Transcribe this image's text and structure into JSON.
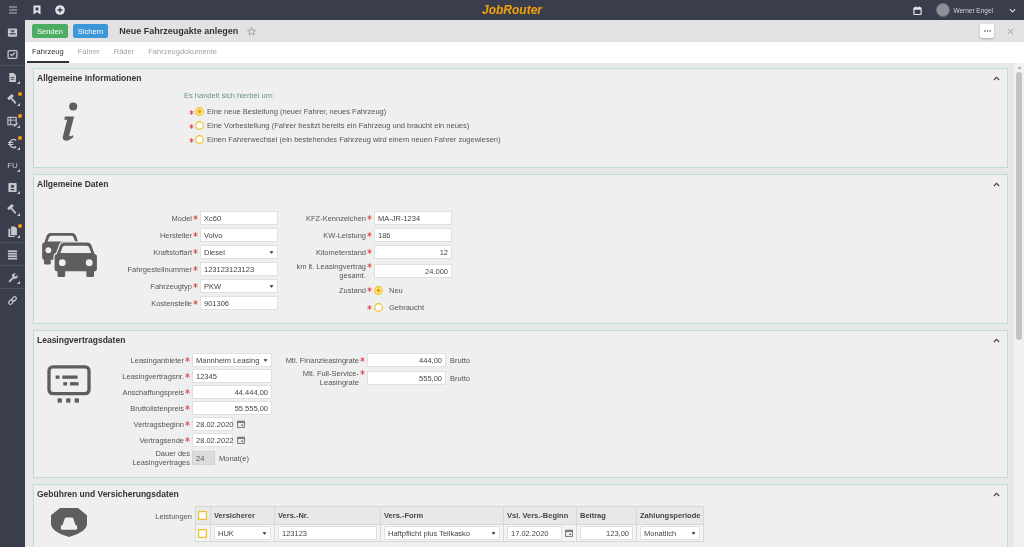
{
  "top_bar": {
    "logo": "JobRouter",
    "user_name": "Werner Engel"
  },
  "sidebar": {
    "groups": [
      {
        "items": [
          {
            "notification": false,
            "submenu": false
          },
          {
            "notification": false,
            "submenu": false
          }
        ]
      },
      {
        "items": [
          {
            "notification": false,
            "submenu": true
          },
          {
            "notification": true,
            "submenu": true
          },
          {
            "notification": true,
            "submenu": true
          },
          {
            "notification": true,
            "submenu": true
          },
          {
            "label": "FU",
            "notification": false,
            "submenu": true
          },
          {
            "notification": false,
            "submenu": true
          },
          {
            "notification": false,
            "submenu": true
          },
          {
            "notification": true,
            "submenu": true
          }
        ]
      },
      {
        "items": [
          {
            "notification": false,
            "submenu": false
          }
        ]
      },
      {
        "items": [
          {
            "notification": false,
            "submenu": true
          }
        ]
      },
      {
        "items": [
          {
            "notification": false,
            "submenu": false
          }
        ]
      }
    ]
  },
  "toolbar": {
    "buttons": [
      {
        "label": "Senden",
        "kind": "success"
      },
      {
        "label": "Sichern",
        "kind": "primary"
      }
    ],
    "title": "Neue Fahrzeugakte anlegen",
    "favorite": false
  },
  "tabs": [
    {
      "label": "Fahrzeug",
      "selected": true
    },
    {
      "label": "Fahrer",
      "selected": false
    },
    {
      "label": "Räder",
      "selected": false
    },
    {
      "label": "Fahrzeugdokumente",
      "selected": false
    }
  ],
  "sections": [
    {
      "kind": "info",
      "title": "Allgemeine Informationen",
      "expanded": true,
      "question": "Es handelt sich hierbei um:",
      "options": [
        {
          "label": "Eine neue Bestellung (neuer Fahrer, neues Fahrzeug)",
          "required": true,
          "selected": true
        },
        {
          "label": "Eine Vorbestellung (Fahrer besitzt bereits ein Fahrzeug und braucht ein neues)",
          "required": true,
          "selected": false
        },
        {
          "label": "Einen Fahrerwechsel (ein bestehendes Fahrzeug wird einem neuen Fahrer zugewiesen)",
          "required": true,
          "selected": false
        }
      ]
    },
    {
      "kind": "vehicle",
      "title": "Allgemeine Daten",
      "expanded": true,
      "columns": [
        [
          {
            "label": "Model",
            "required": true,
            "kind": "text",
            "value": "Xc60"
          },
          {
            "label": "Hersteller",
            "required": true,
            "kind": "text",
            "value": "Volvo"
          },
          {
            "label": "Kraftstoffart",
            "required": true,
            "kind": "select",
            "value": "Diesel"
          },
          {
            "label": "Fahrgestellnummer",
            "required": true,
            "kind": "text",
            "value": "123123123123"
          },
          {
            "label": "Fahrzeugtyp",
            "required": true,
            "kind": "select",
            "value": "PKW"
          },
          {
            "label": "Kostenstelle",
            "required": true,
            "kind": "text",
            "value": "901306"
          }
        ],
        [
          {
            "label": "KFZ-Kennzeichen",
            "required": true,
            "kind": "text",
            "value": "MA-JR-1234"
          },
          {
            "label": "KW-Leistung",
            "required": true,
            "kind": "text",
            "value": "186"
          },
          {
            "label": "Kilometerstand",
            "required": true,
            "kind": "number",
            "value": "12"
          },
          {
            "label": "km lt. Leasingvertrag gesamt.",
            "required": true,
            "kind": "number",
            "value": "24.000"
          },
          {
            "label": "Zustand",
            "required": true,
            "kind": "radio",
            "options": [
              {
                "label": "Neu",
                "selected": true
              },
              {
                "label": "Gebraucht",
                "selected": false
              }
            ]
          }
        ]
      ]
    },
    {
      "kind": "leasing",
      "title": "Leasingvertragsdaten",
      "expanded": true,
      "columns": [
        [
          {
            "label": "Leasinganbieter",
            "required": true,
            "kind": "select",
            "value": "Mannheim Leasing"
          },
          {
            "label": "Leasingvertragsnr.",
            "required": true,
            "kind": "text",
            "value": "12345"
          },
          {
            "label": "Anschaffungspreis",
            "required": true,
            "kind": "number",
            "value": "44.444,00"
          },
          {
            "label": "Bruttolistenpreis",
            "required": true,
            "kind": "number",
            "value": "55.555,00"
          },
          {
            "label": "Vertragsbeginn",
            "required": true,
            "kind": "date",
            "value": "28.02.2020"
          },
          {
            "label": "Vertragsende",
            "required": true,
            "kind": "date",
            "value": "28.02.2022"
          },
          {
            "label": "Dauer des Leasingvertrages",
            "required": false,
            "kind": "readonly",
            "value": "24",
            "unit": "Monat(e)"
          }
        ],
        [
          {
            "label": "Mtl. Finanzleasingrate",
            "required": true,
            "kind": "number",
            "value": "444,00",
            "unit": "Brutto"
          },
          {
            "label": "Mtl. Full-Service-Leasingrate",
            "required": true,
            "kind": "number",
            "value": "555,00",
            "unit": "Brutto"
          }
        ]
      ]
    },
    {
      "kind": "insurance",
      "title": "Gebühren und Versicherungsdaten",
      "expanded": true,
      "table": {
        "label": "Leistungen",
        "all_checked": false,
        "columns": [
          "Versicherer",
          "Vers.-Nr.",
          "Vers.-Form",
          "Vsl. Vers.-Beginn",
          "Beitrag",
          "Zahlungsperiode"
        ],
        "rows": [
          {
            "checked": false,
            "cells": [
              {
                "kind": "select",
                "value": "HUK"
              },
              {
                "kind": "text",
                "value": "123123"
              },
              {
                "kind": "select",
                "value": "Haftpflicht plus Teilkasko"
              },
              {
                "kind": "date",
                "value": "17.02.2020"
              },
              {
                "kind": "number",
                "value": "123,00"
              },
              {
                "kind": "select",
                "value": "Monatlich"
              }
            ]
          }
        ]
      }
    }
  ]
}
